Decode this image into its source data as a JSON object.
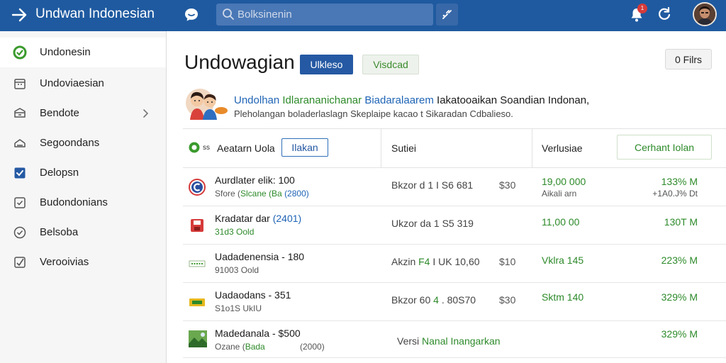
{
  "topbar": {
    "title": "Undwan Indonesian",
    "search_placeholder": "Bolksinenin",
    "bell_badge": "1",
    "bg_color": "#1f5aa0"
  },
  "sidebar": {
    "items": [
      {
        "label": "Undonesin",
        "icon": "check-circle-icon",
        "active": true
      },
      {
        "label": "Undoviaesian",
        "icon": "calendar-icon"
      },
      {
        "label": "Bendote",
        "icon": "box-icon",
        "chevron": true
      },
      {
        "label": "Segoondans",
        "icon": "layers-icon"
      },
      {
        "label": "Delopsn",
        "icon": "checkbox-checked-icon"
      },
      {
        "label": "Budondonians",
        "icon": "checkbox-icon"
      },
      {
        "label": "Belsoba",
        "icon": "check-circle-outline-icon"
      },
      {
        "label": "Verooivias",
        "icon": "checkbox-check-icon"
      }
    ]
  },
  "header": {
    "title": "Undowagian",
    "primary_button": "Ulkleso",
    "secondary_button": "Visdcad",
    "filters_button": "0 Filrs"
  },
  "banner": {
    "line1_blue": "Undolhan",
    "line1_green": "Idlarananichanar",
    "line1_blue2": "Biadaralaarem",
    "line1_dark": "Iakatooaikan Soandian Indonan,",
    "line2": "Pleholangan boladerlaslagn Skeplaipe kacao t Sikaradan Cdbalieso."
  },
  "table": {
    "header": {
      "check_sub": "ss",
      "col1": "Aeatarn Uola",
      "col1_button": "Ilakan",
      "col2": "Sutiei",
      "col3": "Verlusiae",
      "right_button": "Cerhant Iolan"
    },
    "rows": [
      {
        "icon": "c-logo-icon",
        "name": "Aurdlater elik: 100",
        "sub_a": "Sfore (",
        "sub_b": "Slcane (Ba",
        "sub_c": "(2800)",
        "code": "Bkzor d 1  I  S6 681",
        "price": "$30",
        "val": "19,00 000",
        "val2": "Aikali arn",
        "pct": "133% M",
        "pct2": "+1A0.J% Dt"
      },
      {
        "icon": "red-save-icon",
        "name": "Kradatar dar",
        "name_b": "(2401)",
        "sub_a": "",
        "sub_b": "31d3 Oold",
        "sub_c": "",
        "code": "Ukzor  da  1  S5 319",
        "price": "",
        "val": "11,00 00",
        "val2": "",
        "pct": "130T M",
        "pct2": ""
      },
      {
        "icon": "leaf-label-icon",
        "name": "Uadadenensia - 180",
        "sub_a": "91003 Oold",
        "sub_b": "",
        "sub_c": "",
        "code_a": "Akzin",
        "code_b": "F4",
        "code_c": "I  UK 10,60",
        "price": "$10",
        "val": "Vklra 145",
        "val2": "",
        "pct": "223% M",
        "pct2": ""
      },
      {
        "icon": "ticket-icon",
        "name": "Uadaodans  -  351",
        "sub_a": "S1o1S UkIU",
        "sub_b": "",
        "sub_c": "",
        "code_a": "Bkzor 60",
        "code_b": "4",
        "code_c": ". 80S70",
        "price": "$30",
        "val": "Sktm 140",
        "val2": "",
        "pct": "329% M",
        "pct2": ""
      },
      {
        "icon": "photo-icon",
        "name": "Madedanala - $500",
        "sub_a": "Ozane (",
        "sub_b": "Bada",
        "sub_c": "(2000)",
        "note_d": "Versi",
        "note_g": "Nanal Inangarkan",
        "pct": "329% M",
        "pct2": ""
      }
    ]
  }
}
